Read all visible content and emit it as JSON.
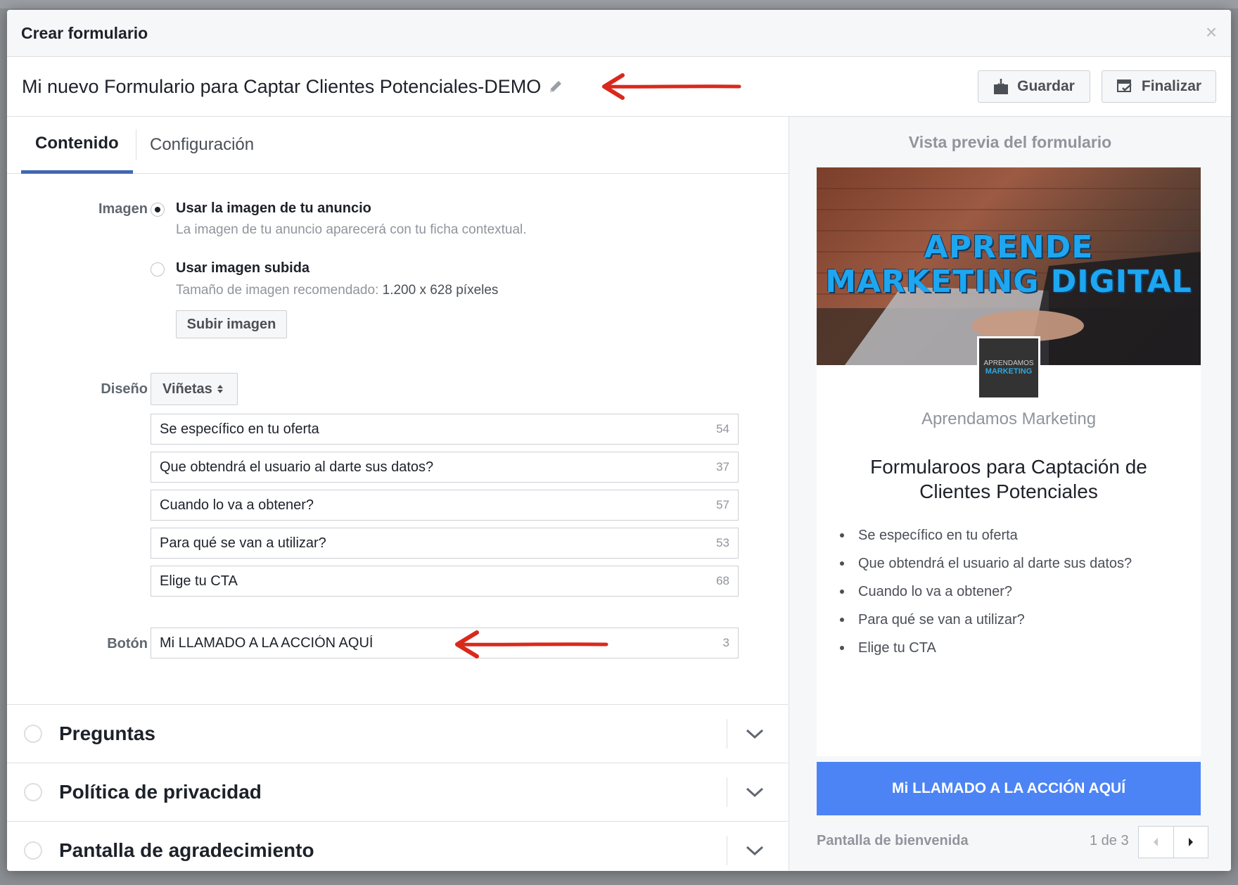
{
  "modal": {
    "title": "Crear formulario",
    "close_icon": "×"
  },
  "form_name": "Mi nuevo Formulario para Captar Clientes Potenciales-DEMO",
  "toolbar": {
    "save_label": "Guardar",
    "finish_label": "Finalizar"
  },
  "tabs": [
    {
      "label": "Contenido",
      "active": true
    },
    {
      "label": "Configuración",
      "active": false
    }
  ],
  "image_section": {
    "label": "Imagen",
    "options": [
      {
        "title": "Usar la imagen de tu anuncio",
        "subtitle": "La imagen de tu anuncio aparecerá con tu ficha contextual.",
        "checked": true
      },
      {
        "title": "Usar imagen subida",
        "subtitle_prefix": "Tamaño de imagen recomendado:",
        "subtitle_value": "1.200 x 628 píxeles",
        "checked": false
      }
    ],
    "upload_button": "Subir imagen"
  },
  "design_section": {
    "label": "Diseño",
    "layout_select": "Viñetas",
    "items": [
      {
        "value": "Se específico en tu oferta",
        "remaining": "54"
      },
      {
        "value": "Que obtendrá el usuario al darte sus datos?",
        "remaining": "37"
      },
      {
        "value": "Cuando lo va a obtener?",
        "remaining": "57"
      },
      {
        "value": "Para qué se van a utilizar?",
        "remaining": "53"
      },
      {
        "value": "Elige tu CTA",
        "remaining": "68"
      }
    ]
  },
  "button_section": {
    "label": "Botón",
    "value": "Mi LLAMADO A LA ACCIÓN AQUÍ",
    "remaining": "3"
  },
  "accordions": [
    {
      "title": "Preguntas"
    },
    {
      "title": "Política de privacidad"
    },
    {
      "title": "Pantalla de agradecimiento"
    }
  ],
  "preview": {
    "title": "Vista previa del formulario",
    "hero_line1": "APRENDE",
    "hero_line2": "MARKETING DIGITAL",
    "logo_line1": "APRENDAMOS",
    "logo_line2": "MARKETING",
    "page_name": "Aprendamos Marketing",
    "headline": "Formularoos para Captación de Clientes Potenciales",
    "bullets": [
      "Se específico en tu oferta",
      "Que obtendrá el usuario al darte sus datos?",
      "Cuando lo va a obtener?",
      "Para qué se van a utilizar?",
      "Elige tu CTA"
    ],
    "cta_label": "Mi LLAMADO A LA ACCIÓN AQUÍ",
    "screen_label": "Pantalla de bienvenida",
    "page_counter": "1 de 3"
  },
  "colors": {
    "accent_blue": "#4267b2",
    "cta_blue": "#4c84f5",
    "annotation_red": "#d9291c"
  }
}
